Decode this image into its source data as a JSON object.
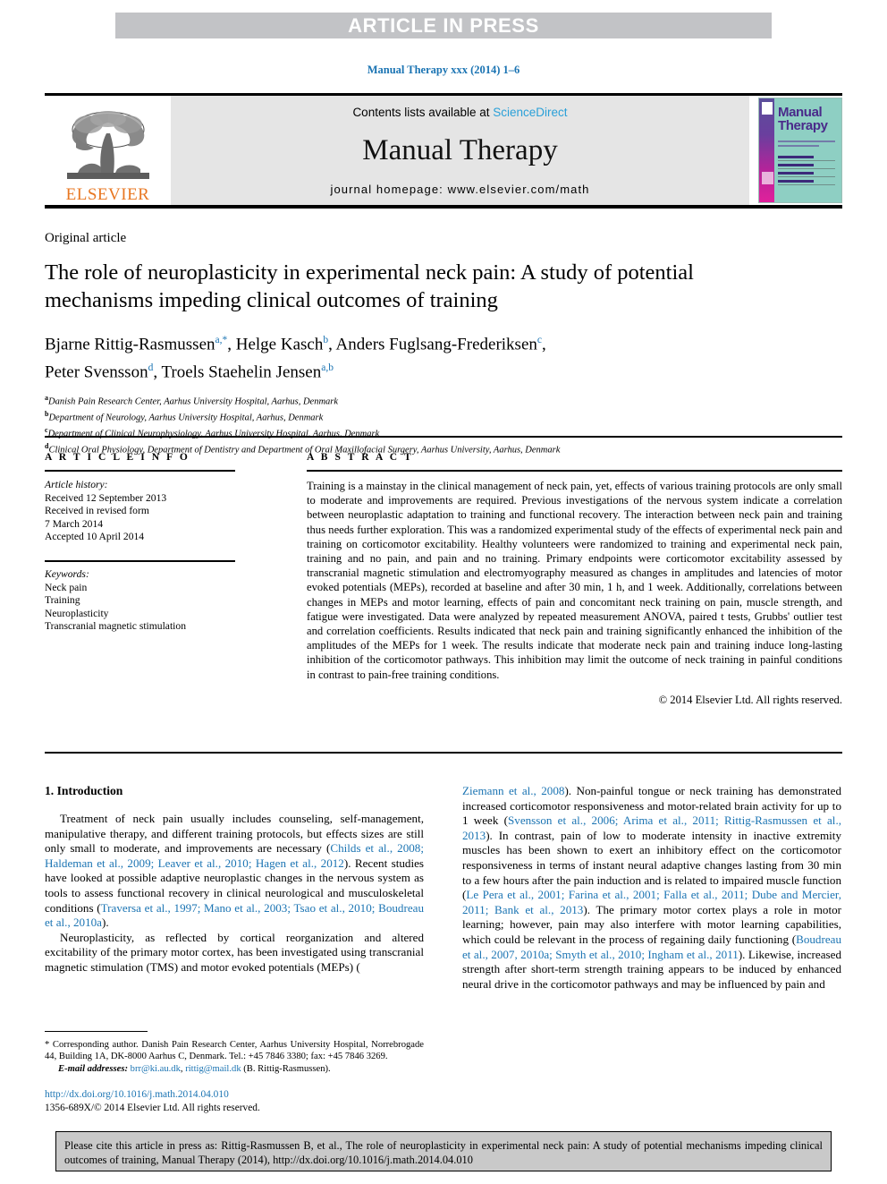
{
  "banner": {
    "text": "ARTICLE IN PRESS"
  },
  "running_head": "Manual Therapy xxx (2014) 1–6",
  "masthead": {
    "contents_prefix": "Contents lists available at ",
    "sciencedirect": "ScienceDirect",
    "journal_name": "Manual Therapy",
    "homepage": "journal homepage: www.elsevier.com/math",
    "publisher": "ELSEVIER",
    "cover_title_line1": "Manual",
    "cover_title_line2": "Therapy"
  },
  "article": {
    "kind": "Original article",
    "title": "The role of neuroplasticity in experimental neck pain: A study of potential mechanisms impeding clinical outcomes of training",
    "authors_line1_a": "Bjarne Rittig-Rasmussen",
    "authors_line1_a_sup": "a,*",
    "authors_line1_b": ", Helge Kasch",
    "authors_line1_b_sup": "b",
    "authors_line1_c": ", Anders Fuglsang-Frederiksen",
    "authors_line1_c_sup": "c",
    "authors_line1_end": ",",
    "authors_line2_a": "Peter Svensson",
    "authors_line2_a_sup": "d",
    "authors_line2_b": ", Troels Staehelin Jensen",
    "authors_line2_b_sup": "a,b",
    "affiliations": [
      {
        "mark": "a",
        "text": "Danish Pain Research Center, Aarhus University Hospital, Aarhus, Denmark"
      },
      {
        "mark": "b",
        "text": "Department of Neurology, Aarhus University Hospital, Aarhus, Denmark"
      },
      {
        "mark": "c",
        "text": "Department of Clinical Neurophysiology, Aarhus University Hospital, Aarhus, Denmark"
      },
      {
        "mark": "d",
        "text": "Clinical Oral Physiology, Department of Dentistry and Department of Oral Maxillofacial Surgery, Aarhus University, Aarhus, Denmark"
      }
    ]
  },
  "article_info": {
    "heading": "A R T I C L E  I N F O",
    "history_label": "Article history:",
    "history": [
      "Received 12 September 2013",
      "Received in revised form",
      "7 March 2014",
      "Accepted 10 April 2014"
    ],
    "keywords_label": "Keywords:",
    "keywords": [
      "Neck pain",
      "Training",
      "Neuroplasticity",
      "Transcranial magnetic stimulation"
    ]
  },
  "abstract": {
    "heading": "A B S T R A C T",
    "text": "Training is a mainstay in the clinical management of neck pain, yet, effects of various training protocols are only small to moderate and improvements are required. Previous investigations of the nervous system indicate a correlation between neuroplastic adaptation to training and functional recovery. The interaction between neck pain and training thus needs further exploration. This was a randomized experimental study of the effects of experimental neck pain and training on corticomotor excitability. Healthy volunteers were randomized to training and experimental neck pain, training and no pain, and pain and no training. Primary endpoints were corticomotor excitability assessed by transcranial magnetic stimulation and electromyography measured as changes in amplitudes and latencies of motor evoked potentials (MEPs), recorded at baseline and after 30 min, 1 h, and 1 week. Additionally, correlations between changes in MEPs and motor learning, effects of pain and concomitant neck training on pain, muscle strength, and fatigue were investigated. Data were analyzed by repeated measurement ANOVA, paired t tests, Grubbs' outlier test and correlation coefficients. Results indicated that neck pain and training significantly enhanced the inhibition of the amplitudes of the MEPs for 1 week. The results indicate that moderate neck pain and training induce long-lasting inhibition of the corticomotor pathways. This inhibition may limit the outcome of neck training in painful conditions in contrast to pain-free training conditions.",
    "copyright": "© 2014 Elsevier Ltd. All rights reserved."
  },
  "introduction": {
    "heading": "1. Introduction",
    "para1_pre": "Treatment of neck pain usually includes counseling, self-management, manipulative therapy, and different training protocols, but effects sizes are still only small to moderate, and improvements are necessary (",
    "para1_cite1": "Childs et al., 2008; Haldeman et al., 2009; Leaver et al., 2010; Hagen et al., 2012",
    "para1_mid": "). Recent studies have looked at possible adaptive neuroplastic changes in the nervous system as tools to assess functional recovery in clinical neurological and musculoskeletal conditions (",
    "para1_cite2": "Traversa et al., 1997; Mano et al., 2003; Tsao et al., 2010; Boudreau et al., 2010a",
    "para1_end": ").",
    "para2_pre": "Neuroplasticity, as reflected by cortical reorganization and altered excitability of the primary motor cortex, has been investigated using transcranial magnetic stimulation (TMS) and motor evoked potentials (MEPs) (",
    "para2_cite1": "Ziemann et al., 2008",
    "para2_mid1": "). Non-painful tongue or neck training has demonstrated increased corticomotor responsiveness and motor-related brain activity for up to 1 week (",
    "para2_cite2": "Svensson et al., 2006; Arima et al., 2011; Rittig-Rasmussen et al., 2013",
    "para2_mid2": "). In contrast, pain of low to moderate intensity in inactive extremity muscles has been shown to exert an inhibitory effect on the corticomotor responsiveness in terms of instant neural adaptive changes lasting from 30 min to a few hours after the pain induction and is related to impaired muscle function (",
    "para2_cite3": "Le Pera et al., 2001; Farina et al., 2001; Falla et al., 2011; Dube and Mercier, 2011; Bank et al., 2013",
    "para2_mid3": "). The primary motor cortex plays a role in motor learning; however, pain may also interfere with motor learning capabilities, which could be relevant in the process of regaining daily functioning (",
    "para2_cite4": "Boudreau et al., 2007, 2010a; Smyth et al., 2010; Ingham et al., 2011",
    "para2_end": "). Likewise, increased strength after short-term strength training appears to be induced by enhanced neural drive in the corticomotor pathways and may be influenced by pain and"
  },
  "footnote": {
    "corresponding": "* Corresponding author. Danish Pain Research Center, Aarhus University Hospital, Norrebrogade 44, Building 1A, DK-8000 Aarhus C, Denmark. Tel.: +45 7846 3380; fax: +45 7846 3269.",
    "email_label": "E-mail addresses:",
    "email1": "brr@ki.au.dk",
    "email_sep": ", ",
    "email2": "rittig@mail.dk",
    "email_attr": " (B. Rittig-Rasmussen)."
  },
  "imprint": {
    "doi": "http://dx.doi.org/10.1016/j.math.2014.04.010",
    "issn_line": "1356-689X/© 2014 Elsevier Ltd. All rights reserved."
  },
  "cite_footer": {
    "text": "Please cite this article in press as: Rittig-Rasmussen B, et al., The role of neuroplasticity in experimental neck pain: A study of potential mechanisms impeding clinical outcomes of training, Manual Therapy (2014), http://dx.doi.org/10.1016/j.math.2014.04.010"
  },
  "colors": {
    "link_blue": "#1b74b3",
    "sciencedirect_blue": "#2aa0d8",
    "elsevier_orange": "#e87722",
    "banner_gray": "#c2c3c6",
    "masthead_gray": "#e5e5e5",
    "footer_gray": "#c9c9c9"
  }
}
